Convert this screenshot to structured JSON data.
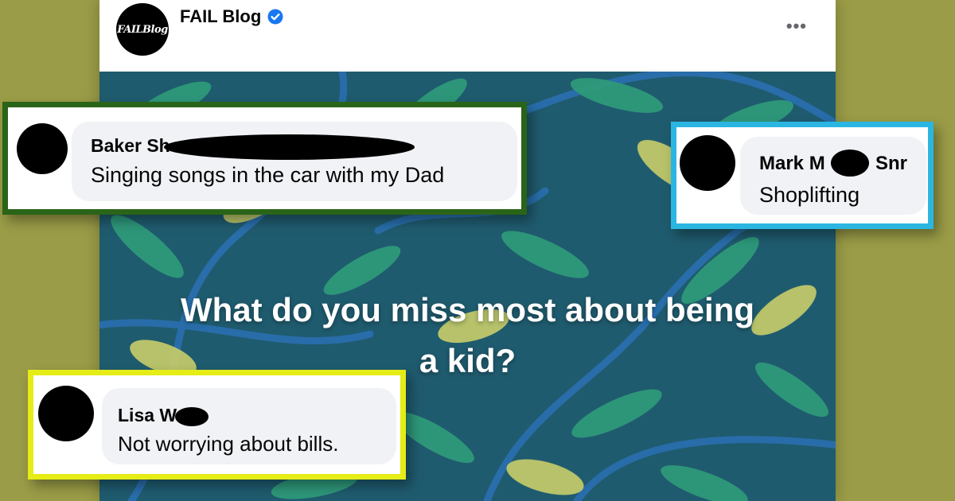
{
  "theme": {
    "background": "#9a9c47",
    "verified_color": "#1877f2"
  },
  "post": {
    "page_name": "FAIL Blog",
    "avatar_text": "FAILBlog",
    "verified_icon": "verified-badge-icon",
    "more_icon": "more-options-icon",
    "more_label": "•••",
    "question_line1": "What do you miss most about being",
    "question_line2": "a kid?",
    "image_colors": {
      "base": "#1f5b6e",
      "leaf_green": "#2f9a7a",
      "leaf_yellow": "#c9cf6a",
      "branch": "#2a6fb0"
    }
  },
  "comments": [
    {
      "name": "Baker Sh",
      "text": "Singing songs in the car with my Dad",
      "border": "#2a6418"
    },
    {
      "name_part1": "Mark M",
      "name_part2": "Snr",
      "text": "Shoplifting",
      "border": "#2bb6e2"
    },
    {
      "name": "Lisa W",
      "text": "Not worrying about bills.",
      "border": "#e6ec16"
    }
  ]
}
